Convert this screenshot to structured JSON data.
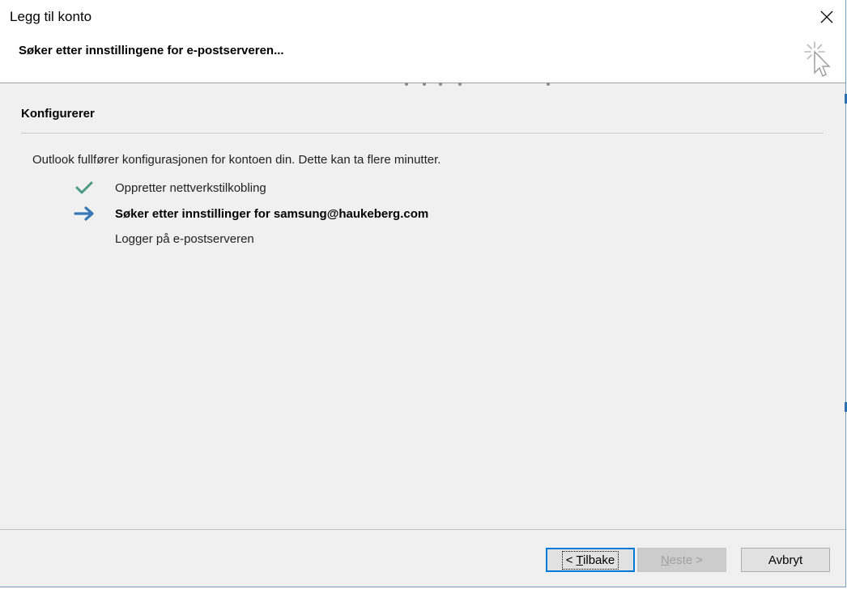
{
  "window": {
    "title": "Legg til konto",
    "close_icon": "close-icon"
  },
  "header": {
    "title": "Søker etter innstillingene for e-postserveren...",
    "busy_icon": "busy-cursor-icon"
  },
  "main": {
    "section_title": "Konfigurerer",
    "description": "Outlook fullfører konfigurasjonen for kontoen din. Dette kan ta flere minutter.",
    "steps": [
      {
        "label": "Oppretter nettverkstilkobling",
        "status": "done",
        "icon": "checkmark-icon"
      },
      {
        "label": "Søker etter innstillinger for samsung@haukeberg.com",
        "status": "active",
        "icon": "arrow-right-icon"
      },
      {
        "label": "Logger på e-postserveren",
        "status": "pending",
        "icon": ""
      }
    ]
  },
  "footer": {
    "back_prefix": "< ",
    "back_mnemonic": "T",
    "back_rest": "ilbake",
    "next_mnemonic": "N",
    "next_rest": "este >",
    "cancel_label": "Avbryt"
  },
  "colors": {
    "check": "#4a9a86",
    "arrow": "#3a78b5",
    "default_border": "#0078d7"
  }
}
